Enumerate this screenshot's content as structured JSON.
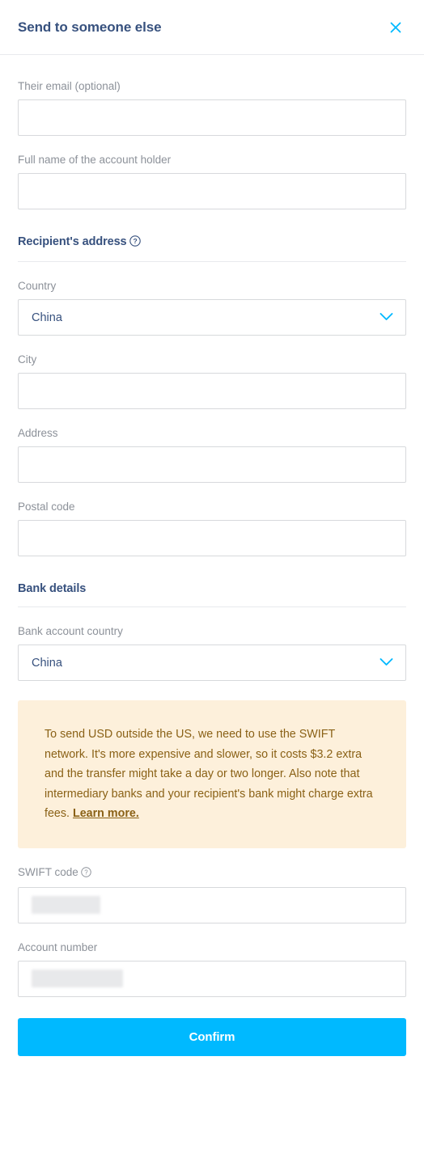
{
  "header": {
    "title": "Send to someone else",
    "close_icon": "close-icon"
  },
  "form": {
    "email": {
      "label": "Their email (optional)",
      "value": "",
      "placeholder": ""
    },
    "full_name": {
      "label": "Full name of the account holder",
      "value": "",
      "placeholder": ""
    },
    "recipient_address_section": {
      "title": "Recipient's address",
      "help_icon": "help-circle-icon"
    },
    "country": {
      "label": "Country",
      "value": "China",
      "chevron_icon": "chevron-down-icon"
    },
    "city": {
      "label": "City",
      "value": "",
      "placeholder": ""
    },
    "address": {
      "label": "Address",
      "value": "",
      "placeholder": ""
    },
    "postal_code": {
      "label": "Postal code",
      "value": "",
      "placeholder": ""
    },
    "bank_details_section": {
      "title": "Bank details"
    },
    "bank_account_country": {
      "label": "Bank account country",
      "value": "China",
      "chevron_icon": "chevron-down-icon"
    },
    "swift_code": {
      "label": "SWIFT code",
      "help_icon": "help-circle-icon",
      "value": "",
      "redacted": true
    },
    "account_number": {
      "label": "Account number",
      "value": "",
      "redacted": true
    }
  },
  "alert": {
    "text": "To send USD outside the US, we need to use the SWIFT network. It's more expensive and slower, so it costs $3.2 extra and the transfer might take a day or two longer. Also note that intermediary banks and your recipient's bank might charge extra fees. ",
    "link_text": "Learn more."
  },
  "actions": {
    "confirm_label": "Confirm"
  },
  "colors": {
    "accent": "#00b9ff",
    "navy": "#37517e",
    "label_gray": "#8c9199",
    "alert_bg": "#fdf0db",
    "alert_text": "#8a6116",
    "border": "#d7d9dc"
  }
}
